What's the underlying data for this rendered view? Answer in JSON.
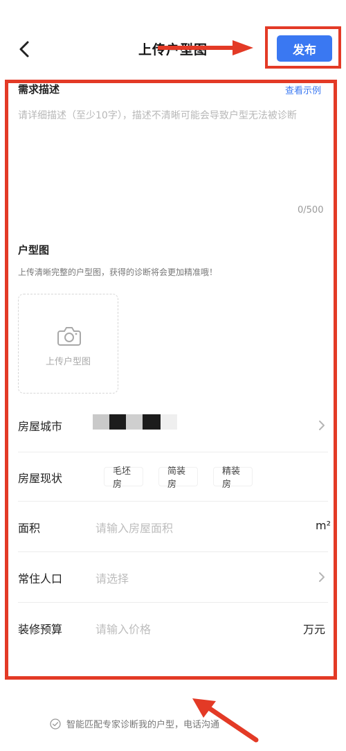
{
  "header": {
    "title": "上传户型图",
    "publish_label": "发布"
  },
  "description": {
    "section_label": "需求描述",
    "view_example": "查看示例",
    "placeholder": "请详细描述（至少10字），描述不清晰可能会导致户型无法被诊断",
    "counter": "0/500"
  },
  "floorplan": {
    "section_label": "户型图",
    "hint": "上传清晰完整的户型图，获得的诊断将会更加精准哦！",
    "upload_label": "上传户型图"
  },
  "form": {
    "city_label": "房屋城市",
    "status_label": "房屋现状",
    "status_options": [
      "毛坯房",
      "简装房",
      "精装房"
    ],
    "area_label": "面积",
    "area_placeholder": "请输入房屋面积",
    "area_unit": "m²",
    "residents_label": "常住人口",
    "residents_placeholder": "请选择",
    "budget_label": "装修预算",
    "budget_placeholder": "请输入价格",
    "budget_unit": "万元"
  },
  "footer": {
    "consent_text": "智能匹配专家诊断我的户型，电话沟通"
  },
  "icons": {
    "back": "chevron-left-icon",
    "camera": "camera-icon",
    "chevron": "chevron-right-icon",
    "check": "check-circle-icon"
  },
  "colors": {
    "accent": "#3a78f2",
    "annotation": "#e33a26"
  }
}
